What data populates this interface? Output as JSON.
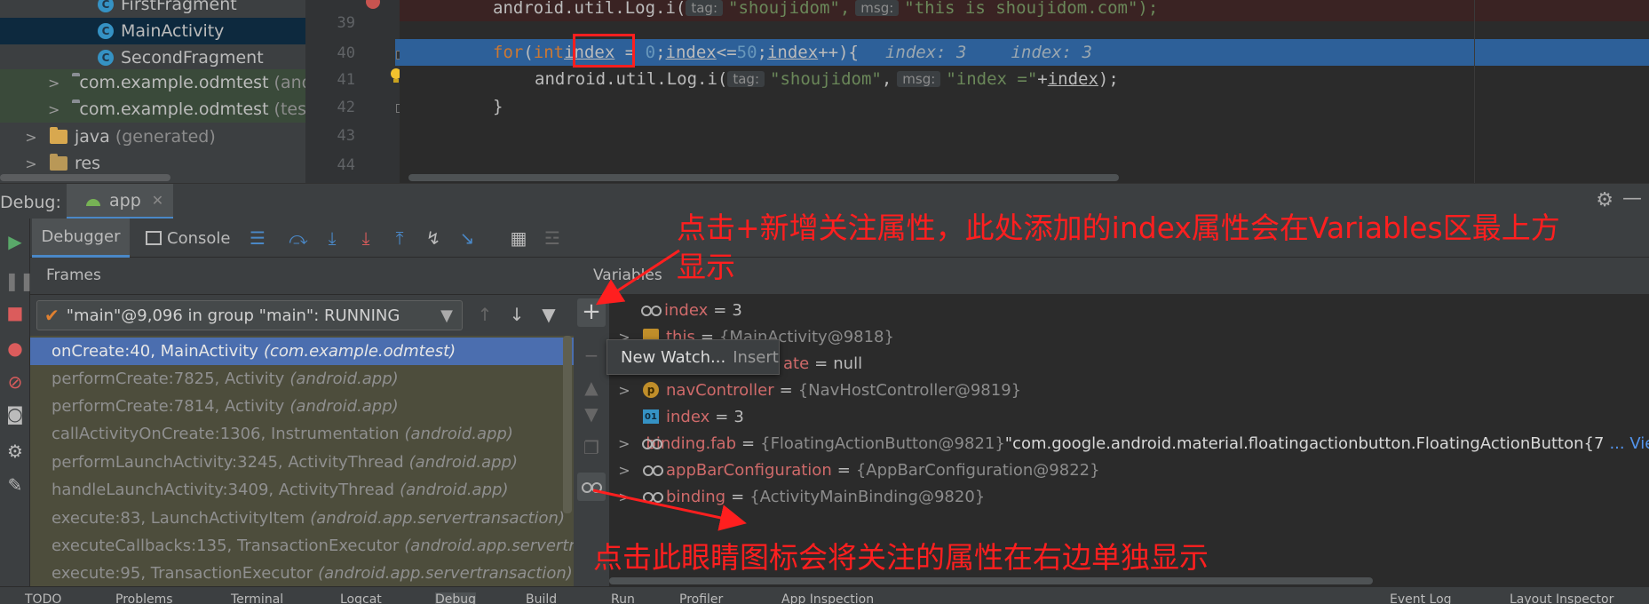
{
  "project_tree": {
    "items": [
      {
        "label": "FirstFragment",
        "suffix": "",
        "icon": "class-icon",
        "chevron": ""
      },
      {
        "label": "MainActivity",
        "suffix": "",
        "icon": "class-icon",
        "chevron": ""
      },
      {
        "label": "SecondFragment",
        "suffix": "",
        "icon": "class-icon",
        "chevron": ""
      },
      {
        "label": "com.example.odmtest",
        "suffix": "(and",
        "icon": "folder-icon",
        "chevron": ">"
      },
      {
        "label": "com.example.odmtest",
        "suffix": "(test",
        "icon": "folder-icon",
        "chevron": ">"
      },
      {
        "label": "java",
        "suffix": "(generated)",
        "icon": "folder-icon",
        "chevron": ">"
      },
      {
        "label": "res",
        "suffix": "",
        "icon": "folder-icon",
        "chevron": ">"
      }
    ]
  },
  "editor": {
    "line_numbers": [
      "39",
      "40",
      "41",
      "42",
      "43",
      "44"
    ],
    "line39": {
      "code": "android.util.Log.i(",
      "tag_hint": "tag:",
      "tag": "\"shoujidom\",",
      "msg_hint": "msg:",
      "msg": "\"this is shoujidom.com\");"
    },
    "line40": {
      "kw_for": "for",
      "paren": "(",
      "kw_int": "int",
      "var": "index",
      "eq": " = ",
      "zero": "0",
      "cond_a": ";",
      "cond_var": "index",
      "cond_op": "<=",
      "fifty": "50",
      "cond_b": ";",
      "inc_var": "index",
      "inc": "++){",
      "inline1": "index: 3",
      "inline2": "index: 3"
    },
    "line41": {
      "code": "android.util.Log.i(",
      "tag_hint": "tag:",
      "tag": "\"shoujidom\"",
      "comma": ",",
      "msg_hint": "msg:",
      "msg": "\"index =\"",
      "plus": "+",
      "var": "index",
      "end": ");"
    },
    "line42": {
      "code": "}"
    }
  },
  "debug": {
    "label": "Debug:",
    "tab": "app",
    "tabs": {
      "debugger": "Debugger",
      "console": "Console"
    }
  },
  "frames": {
    "title": "Frames",
    "thread": "\"main\"@9,096 in group \"main\": RUNNING",
    "items": [
      {
        "method": "onCreate:40, MainActivity",
        "pkg": "(com.example.odmtest)"
      },
      {
        "method": "performCreate:7825, Activity",
        "pkg": "(android.app)"
      },
      {
        "method": "performCreate:7814, Activity",
        "pkg": "(android.app)"
      },
      {
        "method": "callActivityOnCreate:1306, Instrumentation",
        "pkg": "(android.app)"
      },
      {
        "method": "performLaunchActivity:3245, ActivityThread",
        "pkg": "(android.app)"
      },
      {
        "method": "handleLaunchActivity:3409, ActivityThread",
        "pkg": "(android.app)"
      },
      {
        "method": "execute:83, LaunchActivityItem",
        "pkg": "(android.app.servertransaction)"
      },
      {
        "method": "executeCallbacks:135, TransactionExecutor",
        "pkg": "(android.app.servertransa"
      },
      {
        "method": "execute:95, TransactionExecutor",
        "pkg": "(android.app.servertransaction)"
      }
    ]
  },
  "variables": {
    "title": "Variables",
    "items": [
      {
        "name": "index",
        "eq": "=",
        "value": "3",
        "extra": ""
      },
      {
        "name": "this",
        "eq": "=",
        "value": "{MainActivity@9818}",
        "extra": ""
      },
      {
        "name": "ate",
        "eq": "=",
        "value": "null",
        "extra": ""
      },
      {
        "name": "navController",
        "eq": "=",
        "value": "{NavHostController@9819}",
        "extra": ""
      },
      {
        "name": "index",
        "eq": "=",
        "value": "3",
        "extra": ""
      },
      {
        "name": "binding.fab",
        "eq": "=",
        "value": "{FloatingActionButton@9821}",
        "extra": " \"com.google.android.material.floatingactionbutton.FloatingActionButton{7"
      },
      {
        "name": "appBarConfiguration",
        "eq": "=",
        "value": "{AppBarConfiguration@9822}",
        "extra": ""
      },
      {
        "name": "binding",
        "eq": "=",
        "value": "{ActivityMainBinding@9820}",
        "extra": ""
      }
    ],
    "view_link": "... View"
  },
  "popup": {
    "label": "New Watch...",
    "shortcut": "Insert"
  },
  "annotations": {
    "top_line1": "点击+新增关注属性，此处添加的index属性会在Variables区最上方",
    "top_line2": "显示",
    "bottom": "点击此眼睛图标会将关注的属性在右边单独显示"
  },
  "bottom_tabs": [
    "TODO",
    "Problems",
    "Terminal",
    "Logcat",
    "Debug",
    "Build",
    "Run",
    "Profiler",
    "App Inspection",
    "Event Log",
    "Layout Inspector"
  ],
  "colors": {
    "annotation": "#ff1f1f",
    "highlight_line": "#2d6099",
    "selected_frame": "#4b6eaf"
  }
}
